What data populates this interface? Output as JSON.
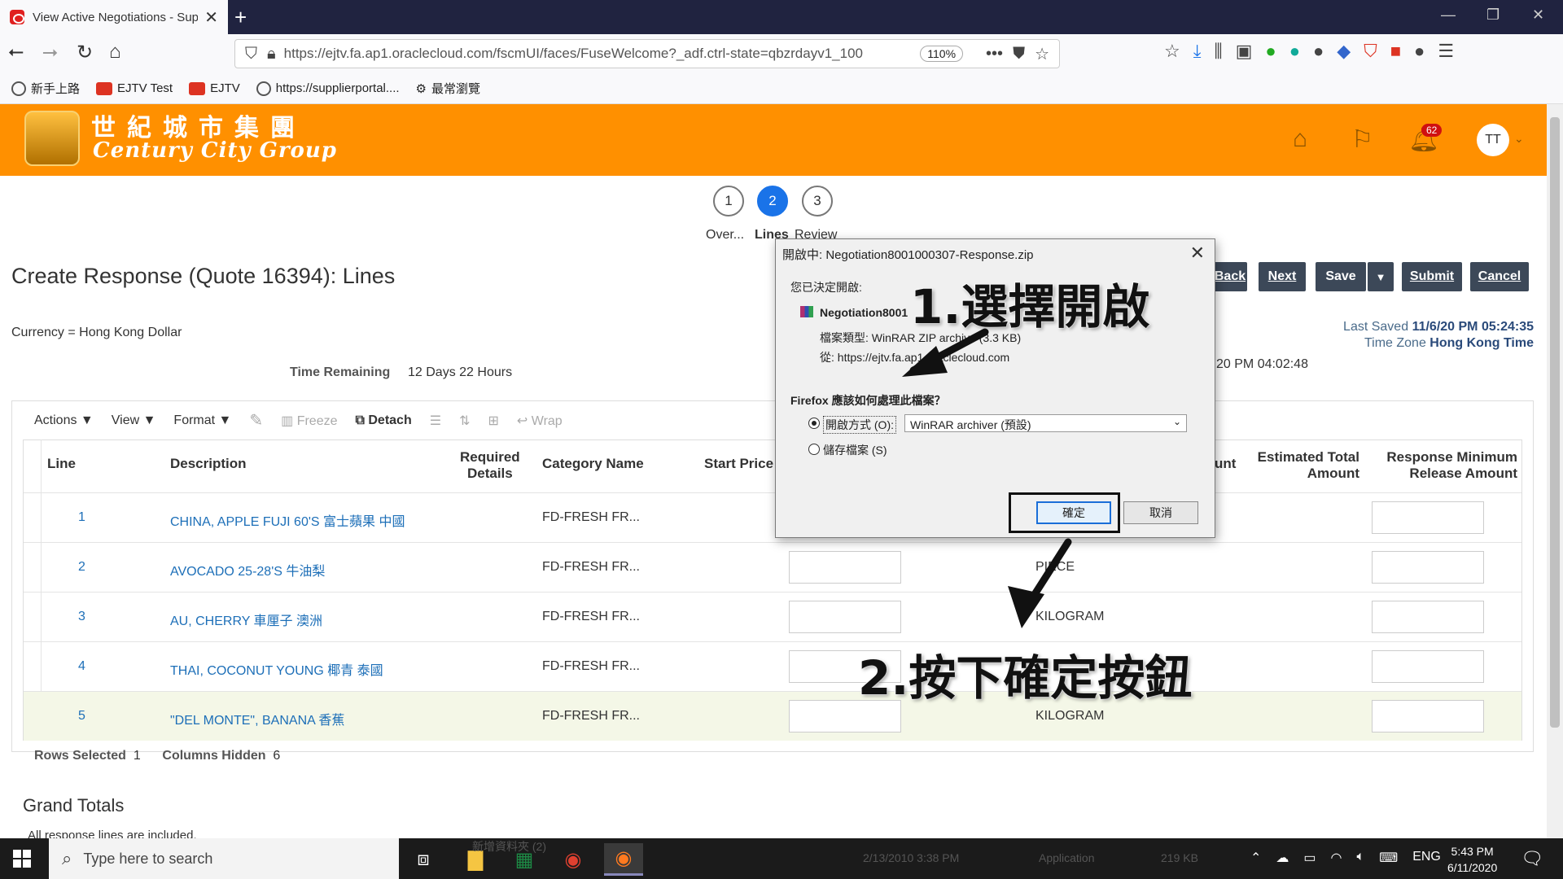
{
  "browser": {
    "tab_title": "View Active Negotiations - Sup",
    "tab_close": "✕",
    "new_tab": "+",
    "url": "https://ejtv.fa.ap1.oraclecloud.com/fscmUI/faces/FuseWelcome?_adf.ctrl-state=qbzrdayv1_100",
    "zoom": "110%",
    "bookmarks": [
      "新手上路",
      "EJTV Test",
      "EJTV",
      "https://supplierportal....",
      "最常瀏覽"
    ]
  },
  "header": {
    "logo_zh": "世紀城市集團",
    "logo_en": "Century City Group",
    "notification_count": "62",
    "avatar": "TT"
  },
  "train": {
    "steps": [
      "1",
      "2",
      "3"
    ],
    "labels": [
      "Over...",
      "Lines",
      "Review"
    ]
  },
  "page": {
    "title": "Create Response (Quote 16394): Lines",
    "currency": "Currency = Hong Kong Dollar",
    "time_remaining_label": "Time Remaining",
    "time_remaining_value": "12 Days 22 Hours",
    "close_partial": "20 PM 04:02:48",
    "last_saved_label": "Last Saved",
    "last_saved_value": "11/6/20 PM 05:24:35",
    "timezone_label": "Time Zone",
    "timezone_value": "Hong Kong Time"
  },
  "buttons": {
    "back": "Back",
    "next": "Next",
    "save": "Save",
    "save_menu": "▼",
    "submit": "Submit",
    "cancel": "Cancel"
  },
  "toolbar": {
    "actions": "Actions ▼",
    "view": "View ▼",
    "format": "Format ▼",
    "freeze": "Freeze",
    "detach": "Detach",
    "wrap": "Wrap"
  },
  "table": {
    "headers": {
      "line": "Line",
      "description": "Description",
      "required_details_1": "Required",
      "required_details_2": "Details",
      "category": "Category Name",
      "start_price": "Start Price",
      "unit_partial": "unt",
      "est_total_1": "Estimated Total",
      "est_total_2": "Amount",
      "resp_min_1": "Response Minimum",
      "resp_min_2": "Release Amount"
    },
    "rows": [
      {
        "line": "1",
        "description": "CHINA, APPLE FUJI 60'S 富士蘋果 中國",
        "category": "FD-FRESH FR...",
        "uom": ""
      },
      {
        "line": "2",
        "description": "AVOCADO 25-28'S 牛油梨",
        "category": "FD-FRESH FR...",
        "uom": "PIECE"
      },
      {
        "line": "3",
        "description": "AU, CHERRY 車厘子 澳洲",
        "category": "FD-FRESH FR...",
        "uom": "KILOGRAM"
      },
      {
        "line": "4",
        "description": "THAI, COCONUT YOUNG 椰青 泰國",
        "category": "FD-FRESH FR...",
        "uom": ""
      },
      {
        "line": "5",
        "description": "\"DEL MONTE\", BANANA 香蕉",
        "category": "FD-FRESH FR...",
        "uom": "KILOGRAM"
      }
    ],
    "rows_selected_label": "Rows Selected",
    "rows_selected_value": "1",
    "columns_hidden_label": "Columns Hidden",
    "columns_hidden_value": "6"
  },
  "grand_totals": {
    "title": "Grand Totals",
    "note": "All response lines are included."
  },
  "dialog": {
    "title": "開啟中: Negotiation8001000307-Response.zip",
    "close": "✕",
    "decided": "您已決定開啟:",
    "file_name": "Negotiation8001",
    "file_type": "檔案類型: WinRAR ZIP archive (3.3 KB)",
    "from": "從: https://ejtv.fa.ap1.oraclecloud.com",
    "question": "Firefox 應該如何處理此檔案？",
    "open_with": "開啟方式 (O):",
    "open_app": "WinRAR archiver (預設)",
    "save_file": "儲存檔案 (S)",
    "ok": "確定",
    "cancel": "取消"
  },
  "annotations": {
    "step1": "1.選擇開啟",
    "step2": "2.按下確定按鈕"
  },
  "taskbar": {
    "search_placeholder": "Type here to search",
    "lang": "ENG",
    "time": "5:43 PM",
    "date": "6/11/2020",
    "ghost": [
      "新增資料夾 (2)",
      "2/13/2010 3:38 PM",
      "Application",
      "219 KB"
    ]
  }
}
